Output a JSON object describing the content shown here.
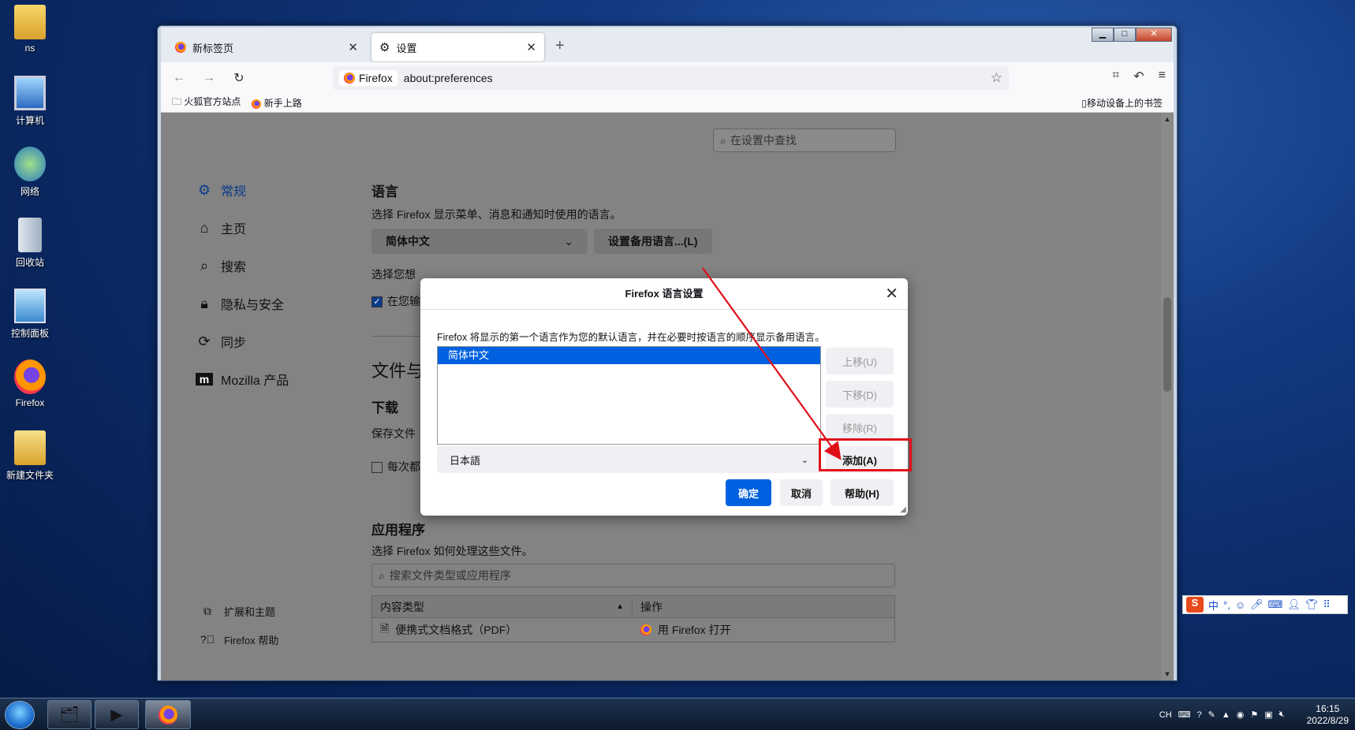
{
  "desktop": {
    "icons": [
      {
        "label": "ns",
        "glyph": "👤"
      },
      {
        "label": "计算机",
        "glyph": "🖥"
      },
      {
        "label": "网络",
        "glyph": "🌐"
      },
      {
        "label": "回收站",
        "glyph": "🗑"
      },
      {
        "label": "控制面板",
        "glyph": "⚙"
      },
      {
        "label": "Firefox",
        "glyph": "🦊"
      },
      {
        "label": "新建文件夹",
        "glyph": "📁"
      }
    ]
  },
  "browser": {
    "tabs": [
      {
        "label": "新标签页"
      },
      {
        "label": "设置"
      }
    ],
    "identity_label": "Firefox",
    "url": "about:preferences",
    "bookmarks": {
      "left": [
        "火狐官方站点",
        "新手上路"
      ],
      "mobile": "移动设备上的书签"
    }
  },
  "prefs": {
    "search_placeholder": "在设置中查找",
    "nav": [
      "常规",
      "主页",
      "搜索",
      "隐私与安全",
      "同步",
      "Mozilla 产品"
    ],
    "nav_bottom": [
      "扩展和主题",
      "Firefox 帮助"
    ],
    "language": {
      "heading": "语言",
      "desc": "选择 Firefox 显示菜单、消息和通知时使用的语言。",
      "current": "简体中文",
      "alt_button": "设置备用语言...(L)",
      "partial_1": "选择您想",
      "partial_2": "在您输"
    },
    "files": {
      "heading_partial": "文件与",
      "downloads": "下载",
      "save_partial": "保存文件",
      "always_partial": "每次都"
    },
    "apps": {
      "heading": "应用程序",
      "desc": "选择 Firefox 如何处理这些文件。",
      "search_placeholder": "搜索文件类型或应用程序",
      "col_type": "内容类型",
      "col_action": "操作",
      "rows": [
        {
          "type": "便携式文档格式（PDF）",
          "action": "用 Firefox 打开"
        }
      ]
    }
  },
  "dialog": {
    "title": "Firefox 语言设置",
    "desc": "Firefox 将显示的第一个语言作为您的默认语言，并在必要时按语言的顺序显示备用语言。",
    "languages": [
      "简体中文"
    ],
    "move_up": "上移(U)",
    "move_down": "下移(D)",
    "remove": "移除(R)",
    "select_value": "日本語",
    "add": "添加(A)",
    "ok": "确定",
    "cancel": "取消",
    "help": "帮助(H)"
  },
  "ime": {
    "brand": "S",
    "mode": "中"
  },
  "taskbar": {
    "lang": "CH",
    "time": "16:15",
    "date": "2022/8/29"
  },
  "colors": {
    "accent": "#0061e0",
    "annotation": "#e0101a"
  }
}
